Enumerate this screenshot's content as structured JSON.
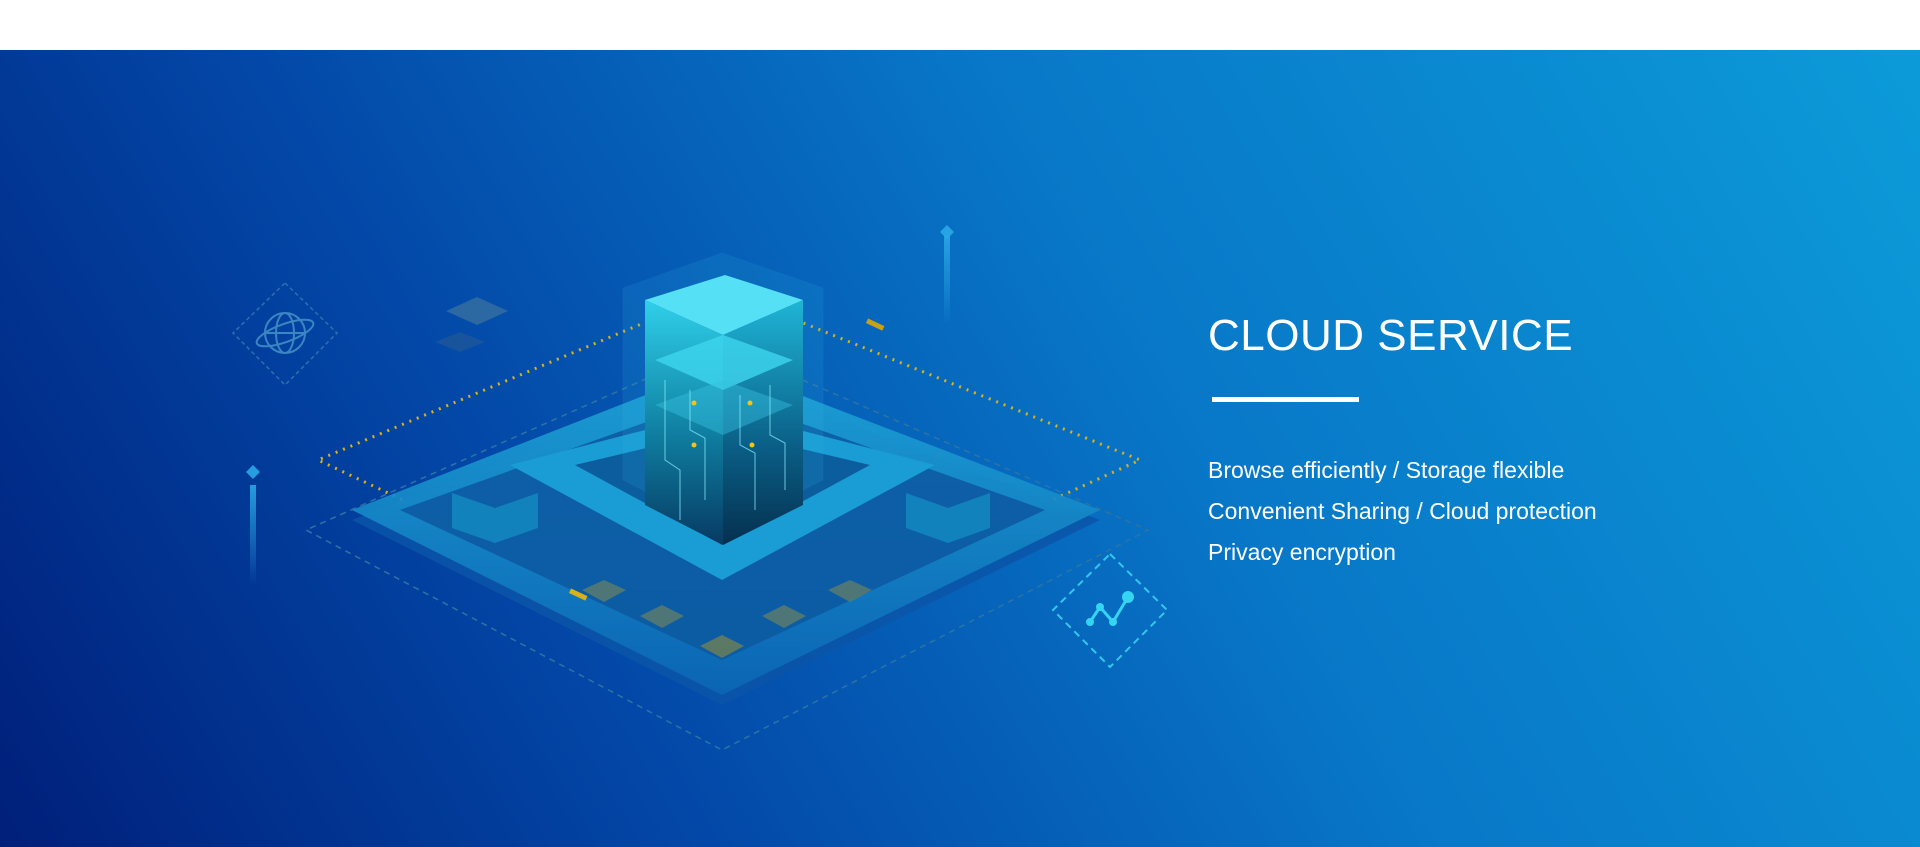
{
  "banner": {
    "title": "CLOUD SERVICE",
    "features": [
      "Browse efficiently / Storage flexible",
      "Convenient Sharing / Cloud protection",
      "Privacy encryption"
    ]
  },
  "colors": {
    "background_dark": "#001f7a",
    "background_light": "#0c9bd9",
    "accent_cyan": "#35d4f2",
    "accent_gold": "#d9b21a",
    "text": "#ffffff"
  },
  "icons": [
    "globe-icon",
    "line-chart-icon",
    "server-cube-icon"
  ]
}
